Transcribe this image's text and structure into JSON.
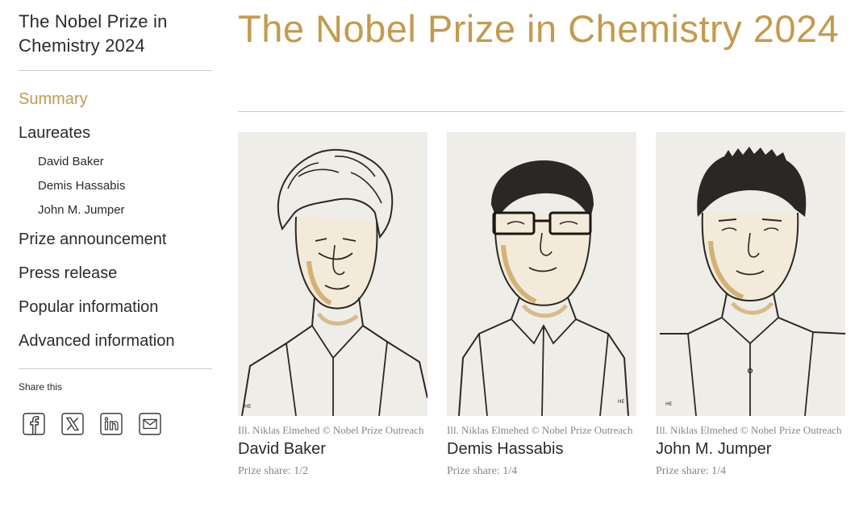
{
  "sidebar": {
    "title": "The Nobel Prize in Chemistry 2024",
    "nav": {
      "summary": "Summary",
      "laureates": "Laureates",
      "sub": [
        "David Baker",
        "Demis Hassabis",
        "John M. Jumper"
      ],
      "prize_announcement": "Prize announcement",
      "press_release": "Press release",
      "popular_information": "Popular information",
      "advanced_information": "Advanced information"
    },
    "share_label": "Share this",
    "share_icons": [
      "facebook-icon",
      "x-icon",
      "linkedin-icon",
      "email-icon"
    ]
  },
  "main": {
    "title": "The Nobel Prize in Chemistry 2024",
    "laureates": [
      {
        "credit": "Ill. Niklas Elmehed © Nobel Prize Outreach",
        "name": "David Baker",
        "share": "Prize share: 1/2"
      },
      {
        "credit": "Ill. Niklas Elmehed © Nobel Prize Outreach",
        "name": "Demis Hassabis",
        "share": "Prize share: 1/4"
      },
      {
        "credit": "Ill. Niklas Elmehed © Nobel Prize Outreach",
        "name": "John M. Jumper",
        "share": "Prize share: 1/4"
      }
    ]
  },
  "colors": {
    "accent": "#c49a4d",
    "text": "#2e2a27",
    "muted": "#8a8580",
    "portrait_bg": "#efede8"
  }
}
